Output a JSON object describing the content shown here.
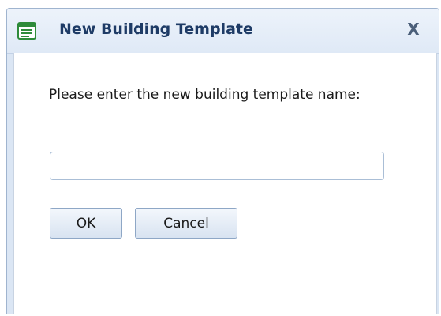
{
  "dialog": {
    "title": "New Building Template",
    "title_icon": "form-window-icon",
    "close_label": "X",
    "prompt": "Please enter the new building template name:",
    "input": {
      "value": "",
      "placeholder": ""
    },
    "ok_label": "OK",
    "cancel_label": "Cancel"
  },
  "colors": {
    "title_text": "#1e3b66",
    "titlebar_bg": "#e4edf8",
    "icon_green": "#2e8b3a",
    "button_border": "#8ea7c6"
  }
}
